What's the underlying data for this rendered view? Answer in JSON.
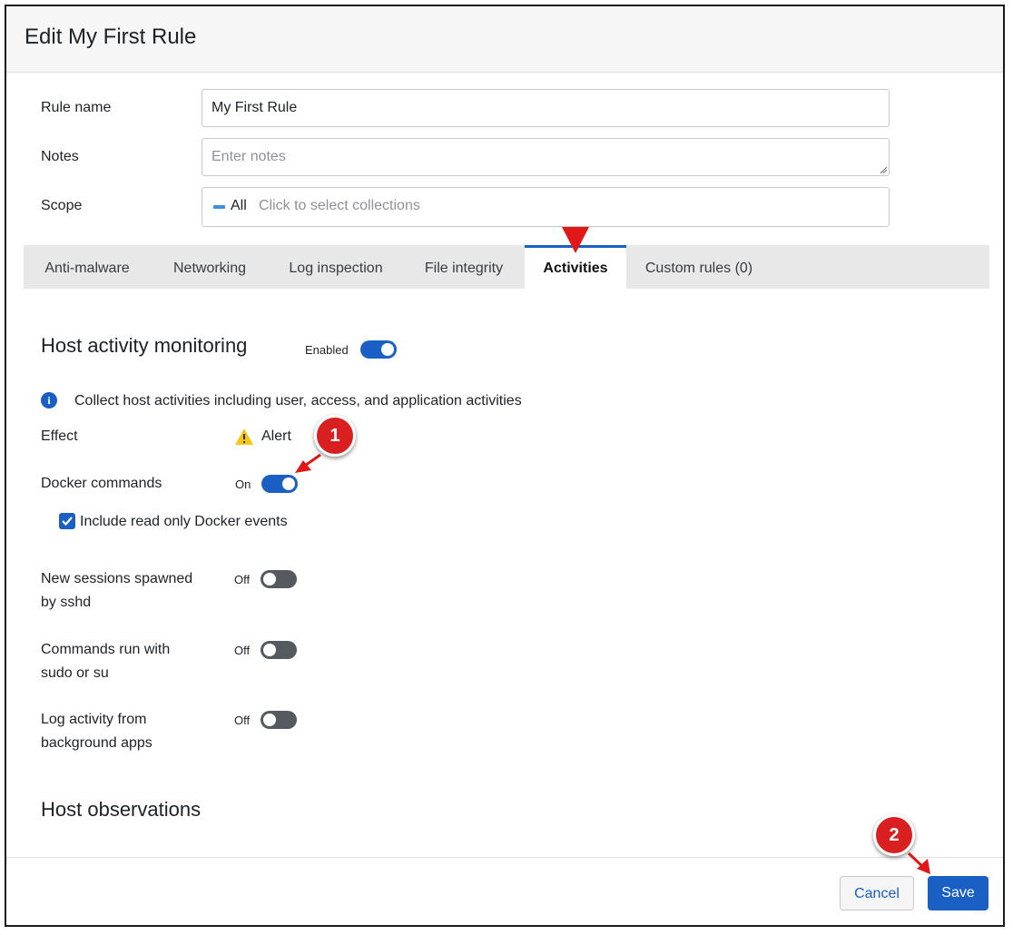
{
  "dialog": {
    "title": "Edit My First Rule"
  },
  "form": {
    "rule_name_label": "Rule name",
    "rule_name_value": "My First Rule",
    "notes_label": "Notes",
    "notes_placeholder": "Enter notes",
    "scope_label": "Scope",
    "scope_all": "All",
    "scope_placeholder": "Click to select collections"
  },
  "tabs": [
    {
      "label": "Anti-malware"
    },
    {
      "label": "Networking"
    },
    {
      "label": "Log inspection"
    },
    {
      "label": "File integrity"
    },
    {
      "label": "Activities",
      "active": true
    },
    {
      "label": "Custom rules (0)"
    }
  ],
  "host_activity": {
    "title": "Host activity monitoring",
    "enabled_label": "Enabled",
    "enabled": true,
    "info_text": "Collect host activities including user, access, and application activities",
    "effect_label": "Effect",
    "effect_value": "Alert",
    "docker_label": "Docker commands",
    "docker_state": "On",
    "docker_on": true,
    "readonly_label": "Include read only Docker events",
    "readonly_checked": true,
    "sshd_label_1": "New sessions spawned",
    "sshd_label_2": "by sshd",
    "sshd_state": "Off",
    "sudo_label_1": "Commands run with",
    "sudo_label_2": "sudo or su",
    "sudo_state": "Off",
    "bg_label_1": "Log activity from",
    "bg_label_2": "background apps",
    "bg_state": "Off"
  },
  "host_observations": {
    "title": "Host observations"
  },
  "footer": {
    "cancel_label": "Cancel",
    "save_label": "Save"
  },
  "annotations": {
    "badge_1": "1",
    "badge_2": "2"
  },
  "colors": {
    "accent": "#1a5fc4",
    "annotation": "#d92020",
    "warning": "#f5c518"
  }
}
